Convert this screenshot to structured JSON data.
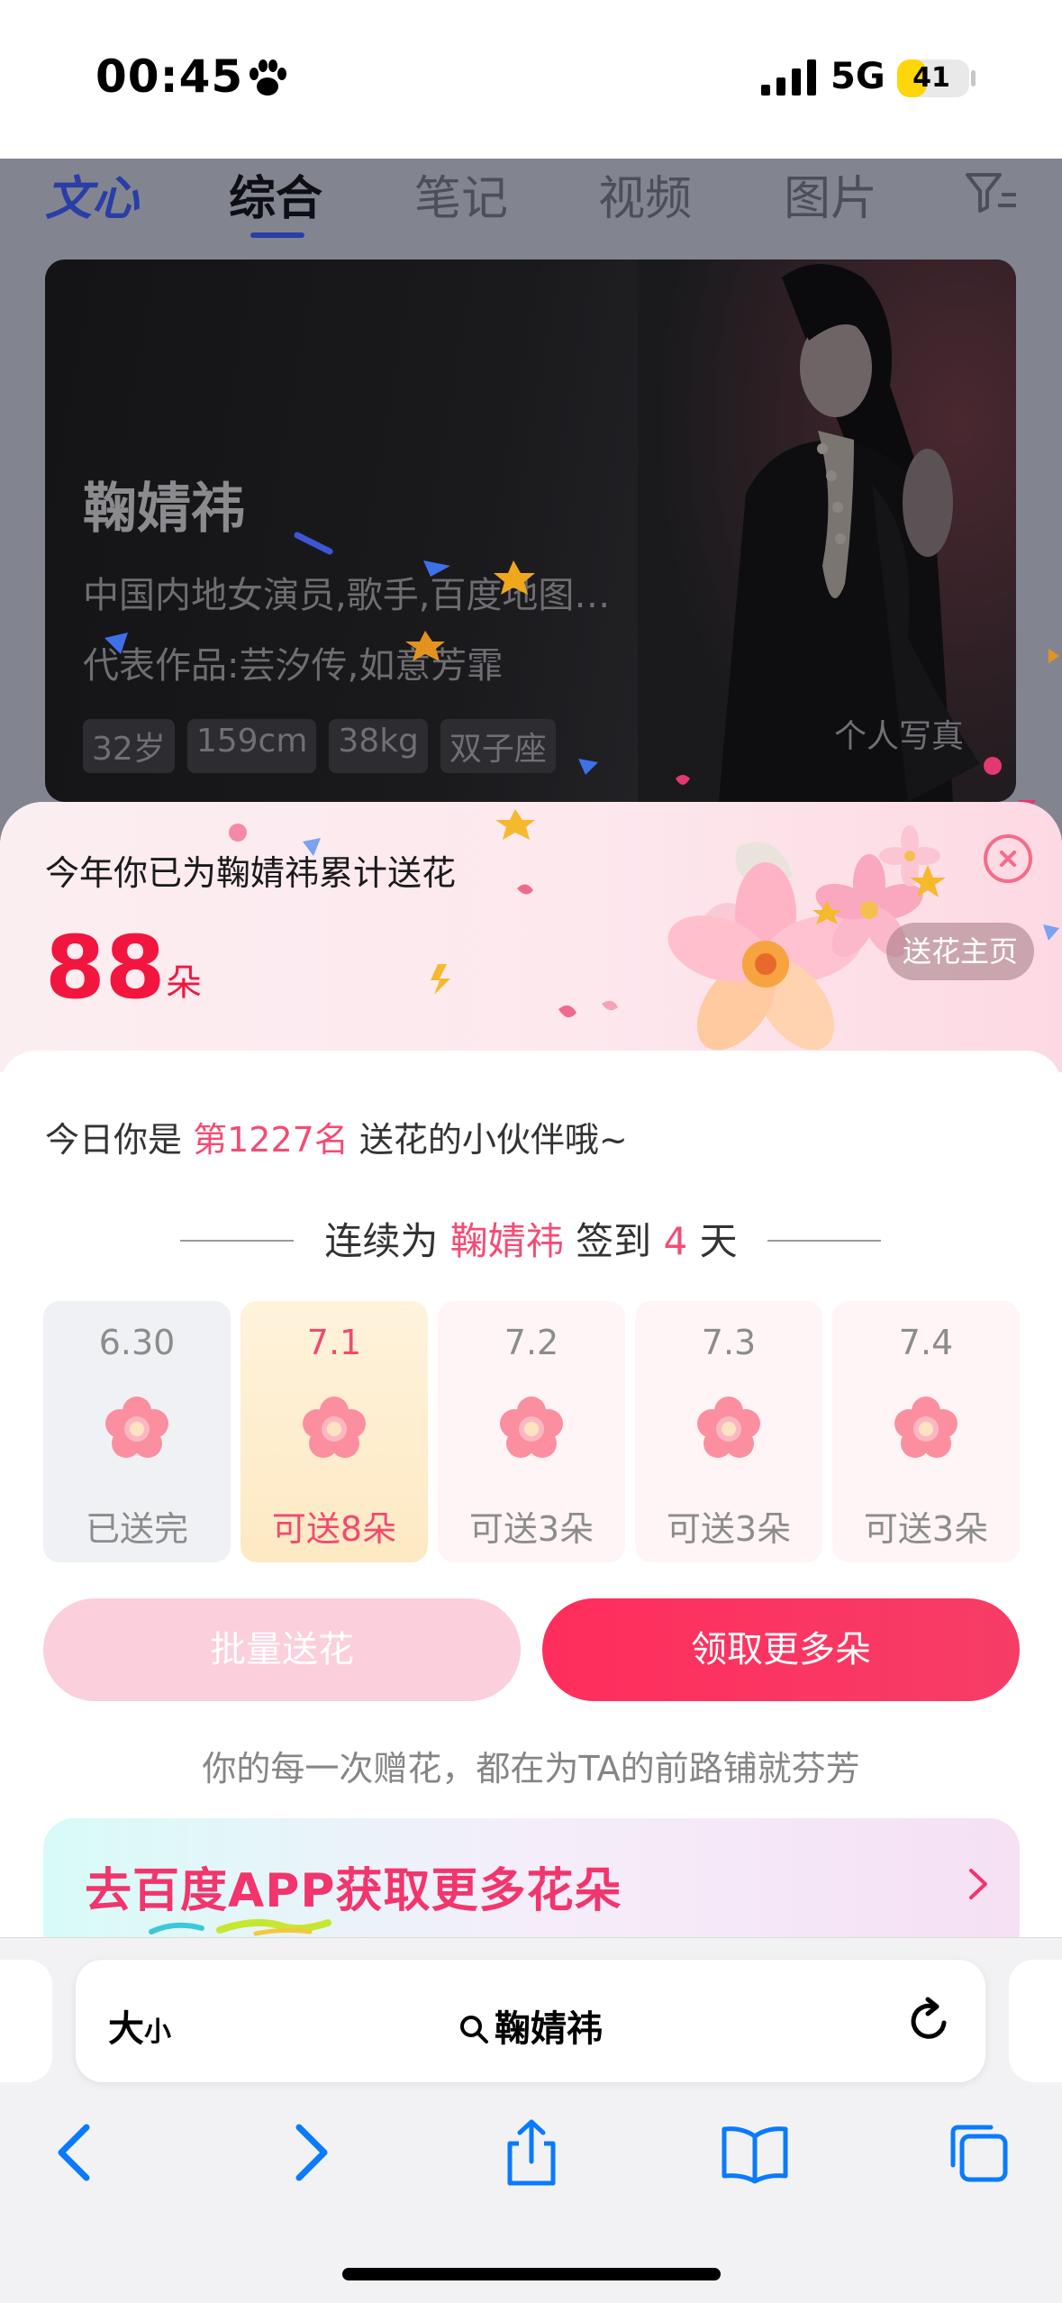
{
  "status_bar": {
    "time": "00:45",
    "network": "5G",
    "battery": "41",
    "battery_level": 0.41
  },
  "tabs": [
    {
      "label": "文心"
    },
    {
      "label": "综合"
    },
    {
      "label": "笔记"
    },
    {
      "label": "视频"
    },
    {
      "label": "图片"
    }
  ],
  "hero": {
    "name": "鞠婧祎",
    "description": "中国内地女演员,歌手,百度地图…",
    "works": "代表作品:芸汐传,如意芳霏",
    "tags": [
      "32岁",
      "159cm",
      "38kg",
      "双子座"
    ],
    "photos_link": "个人写真"
  },
  "sheet": {
    "title": "今年你已为鞠婧祎累计送花",
    "count": "88",
    "unit": "朵",
    "home_button": "送花主页",
    "rank_prefix": "今日你是",
    "rank_value": "第1227名",
    "rank_suffix": "送花的小伙伴哦~",
    "streak_prefix": "连续为",
    "streak_name": "鞠婧祎",
    "streak_mid": "签到",
    "streak_days": "4",
    "streak_suffix": "天",
    "days": [
      {
        "date": "6.30",
        "label": "已送完"
      },
      {
        "date": "7.1",
        "label": "可送8朵"
      },
      {
        "date": "7.2",
        "label": "可送3朵"
      },
      {
        "date": "7.3",
        "label": "可送3朵"
      },
      {
        "date": "7.4",
        "label": "可送3朵"
      }
    ],
    "batch_button": "批量送花",
    "more_button": "领取更多朵",
    "slogan": "你的每一次赠花，都在为TA的前路铺就芬芳",
    "app_banner": "去百度APP获取更多花朵"
  },
  "browser": {
    "text_size_big": "大",
    "text_size_small": "小",
    "url_query": "鞠婧祎"
  },
  "colors": {
    "accent": "#f2163f",
    "highlight": "#f54b74",
    "primary_button": "#ff2d5c",
    "secondary_button": "#fccfdc",
    "ios_blue": "#0a7aff"
  }
}
